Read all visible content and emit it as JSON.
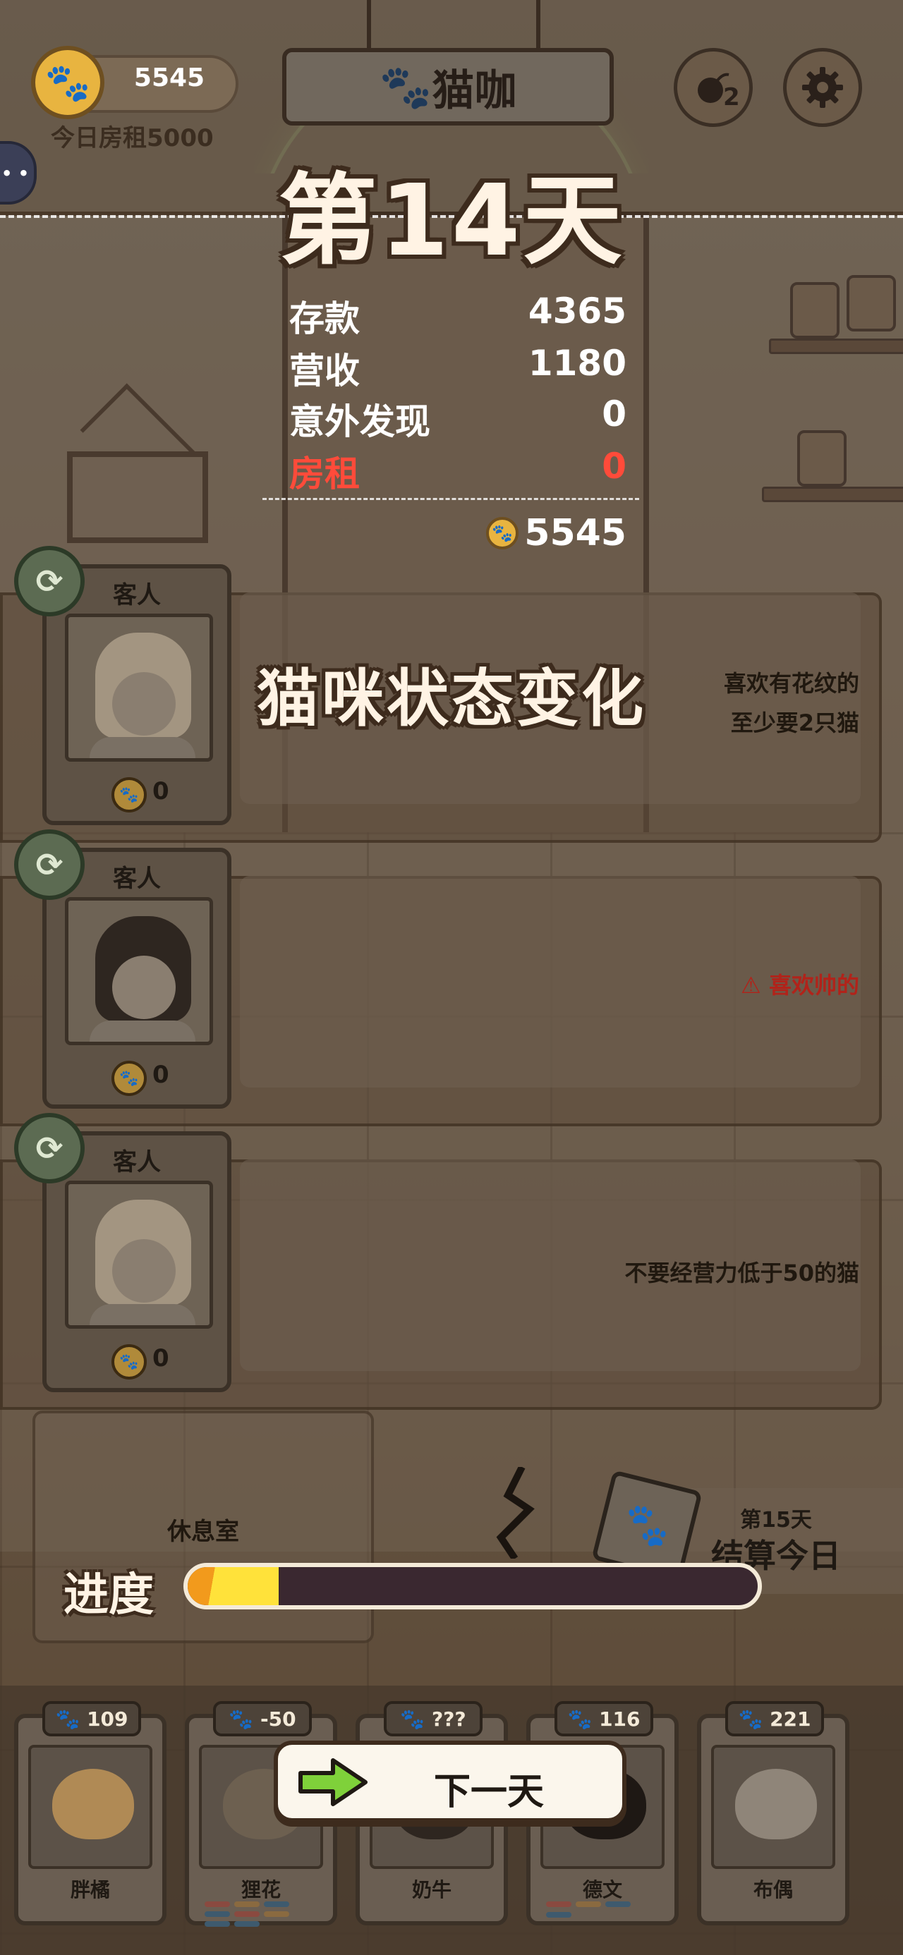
{
  "hud": {
    "coins": "5545",
    "rent_today": "今日房租5000",
    "bomb_count": "2",
    "shop_sign": "猫咖"
  },
  "summary": {
    "day_title": "第14天",
    "rows": [
      {
        "label": "存款",
        "value": "4365"
      },
      {
        "label": "营收",
        "value": "1180"
      },
      {
        "label": "意外发现",
        "value": "0"
      },
      {
        "label": "房租",
        "value": "0"
      }
    ],
    "total": "5545"
  },
  "state_banner": "猫咪状态变化",
  "guests": [
    {
      "label": "客人",
      "coins": "0",
      "requirements": [
        "喜欢有花纹的",
        "至少要2只猫"
      ],
      "warning": false
    },
    {
      "label": "客人",
      "coins": "0",
      "requirements": [
        "喜欢帅的"
      ],
      "warning": true
    },
    {
      "label": "客人",
      "coins": "0",
      "requirements": [
        "不要经营力低于50的猫"
      ],
      "warning": false
    }
  ],
  "rest_room": "休息室",
  "settle": {
    "day": "第15天",
    "label": "结算今日"
  },
  "progress": {
    "label": "进度",
    "fraction": 0.16
  },
  "cats": [
    {
      "score": "109",
      "name": "胖橘"
    },
    {
      "score": "-50",
      "name": "狸花"
    },
    {
      "score": "???",
      "name": "奶牛"
    },
    {
      "score": "116",
      "name": "德文"
    },
    {
      "score": "221",
      "name": "布偶"
    }
  ],
  "next_button": "下一天",
  "colors": {
    "accent_red": "#ff4b3a",
    "warn_red": "#b1231a",
    "progress_orange": "#f29a1c",
    "progress_yellow": "#ffe23a",
    "next_arrow_green": "#7fd13a"
  }
}
